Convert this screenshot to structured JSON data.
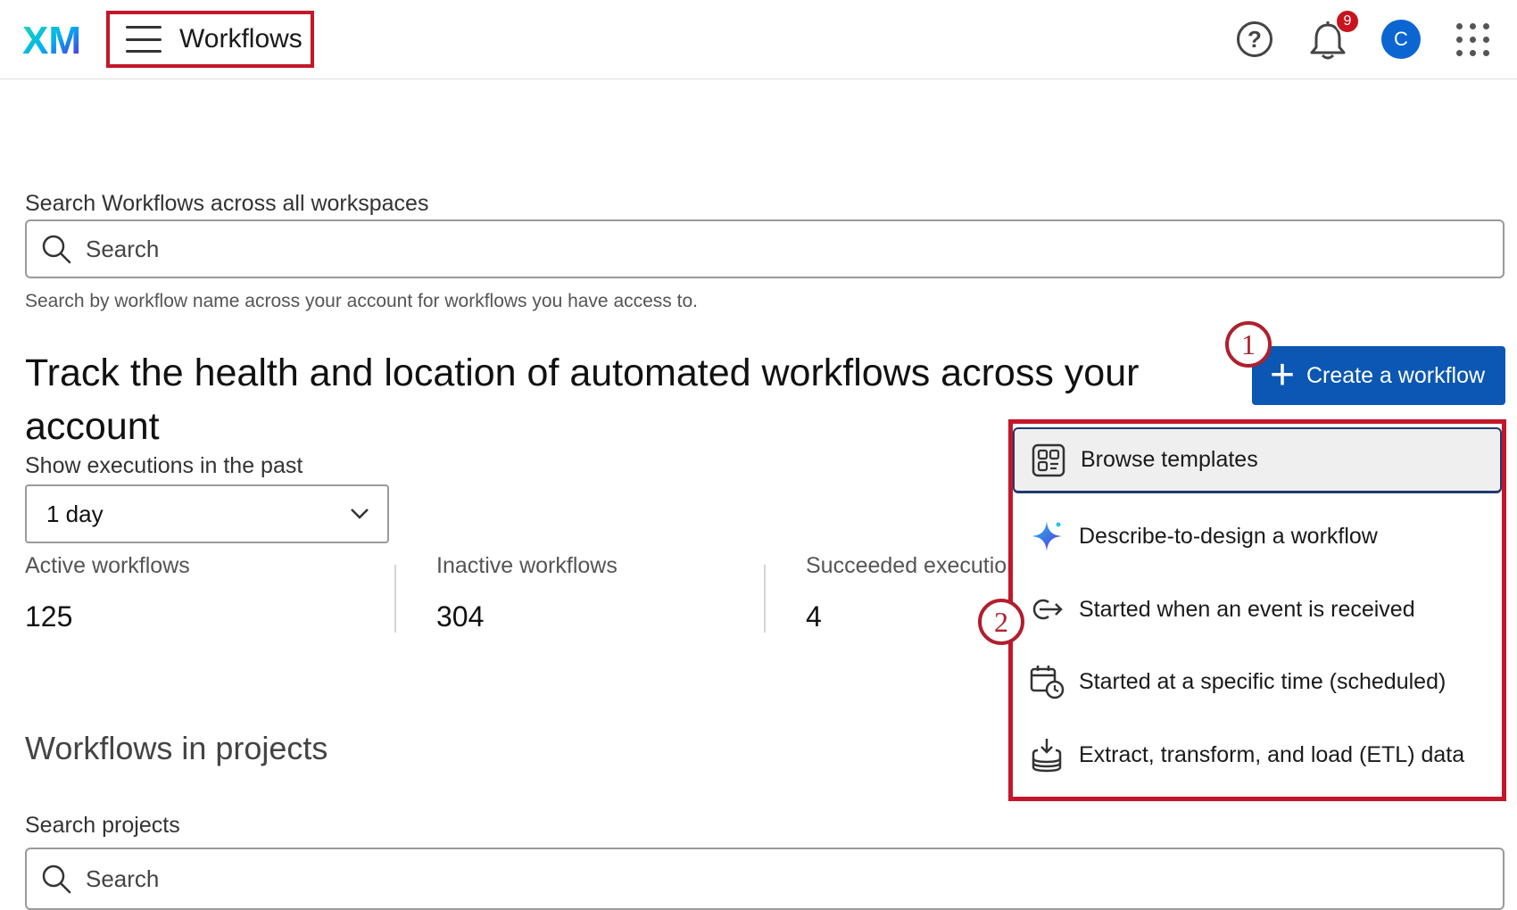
{
  "header": {
    "logo_text": "XM",
    "nav_title": "Workflows",
    "help_label": "?",
    "notifications_count": "9",
    "avatar_initial": "C"
  },
  "search": {
    "label": "Search Workflows across all workspaces",
    "placeholder": "Search",
    "helper_text": "Search by workflow name across your account for workflows you have access to."
  },
  "heading": "Track the health and location of automated workflows across your account",
  "create_button": {
    "label": "Create a workflow",
    "plus": "+"
  },
  "callouts": [
    "1",
    "2"
  ],
  "executions": {
    "label": "Show executions in the past",
    "selected": "1 day"
  },
  "stats": [
    {
      "label": "Active workflows",
      "value": "125"
    },
    {
      "label": "Inactive workflows",
      "value": "304"
    },
    {
      "label": "Succeeded executions",
      "value": "4"
    }
  ],
  "projects": {
    "heading": "Workflows in projects",
    "search_label": "Search projects",
    "search_placeholder": "Search"
  },
  "menu": {
    "items": [
      {
        "label": "Browse templates",
        "icon": "templates-icon"
      },
      {
        "label": "Describe-to-design a workflow",
        "icon": "sparkle-icon"
      },
      {
        "label": "Started when an event is received",
        "icon": "event-trigger-icon"
      },
      {
        "label": "Started at a specific time (scheduled)",
        "icon": "calendar-clock-icon"
      },
      {
        "label": "Extract, transform, and load (ETL) data",
        "icon": "database-download-icon"
      }
    ]
  },
  "colors": {
    "accent": "#0b57b3",
    "highlight_border": "#c4162a",
    "avatar": "#0b66d1",
    "badge": "#c8141e"
  }
}
